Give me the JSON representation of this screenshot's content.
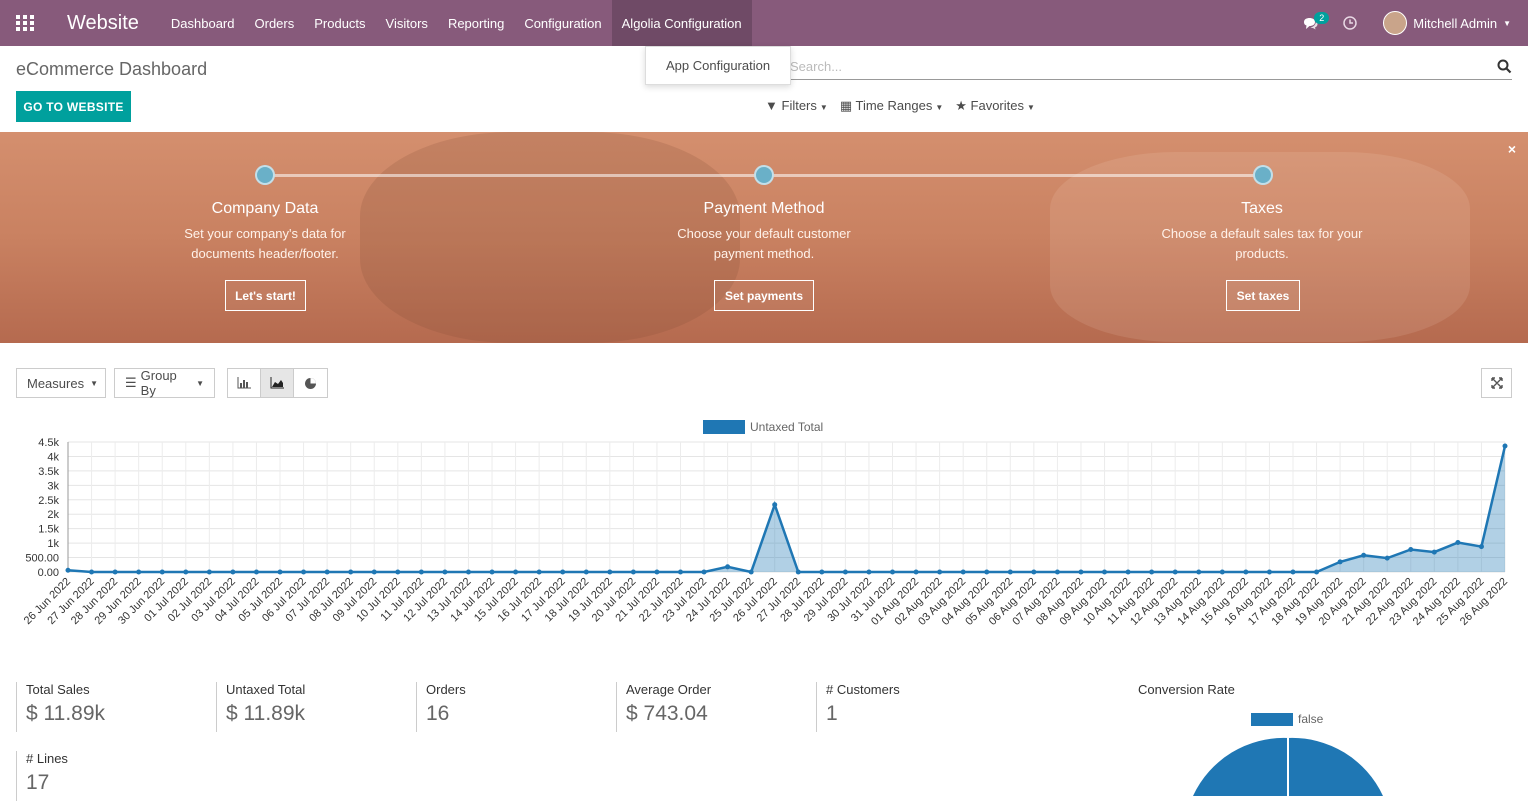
{
  "navbar": {
    "app_title": "Website",
    "menu": [
      "Dashboard",
      "Orders",
      "Products",
      "Visitors",
      "Reporting",
      "Configuration",
      "Algolia Configuration"
    ],
    "messages_count": "2",
    "user_name": "Mitchell Admin",
    "bg_color": "#875a7b"
  },
  "dropdown": {
    "item": "App Configuration"
  },
  "control_panel": {
    "breadcrumb": "eCommerce Dashboard",
    "go_to_website": "GO TO WEBSITE",
    "search_placeholder": "Search...",
    "filters": "Filters",
    "time_ranges": "Time Ranges",
    "favorites": "Favorites"
  },
  "banner": {
    "steps": [
      {
        "title": "Company Data",
        "desc_line1": "Set your company's data for",
        "desc_line2": "documents header/footer.",
        "button": "Let's start!"
      },
      {
        "title": "Payment Method",
        "desc_line1": "Choose your default customer",
        "desc_line2": "payment method.",
        "button": "Set payments"
      },
      {
        "title": "Taxes",
        "desc_line1": "Choose a default sales tax for your",
        "desc_line2": "products.",
        "button": "Set taxes"
      }
    ],
    "close": "×"
  },
  "graph_controls": {
    "measures": "Measures",
    "group_by": "Group By"
  },
  "chart_data": {
    "type": "area",
    "legend": [
      "Untaxed Total"
    ],
    "color": "#1f77b4",
    "y_ticks": [
      "0.00",
      "500.00",
      "1k",
      "1.5k",
      "2k",
      "2.5k",
      "3k",
      "3.5k",
      "4k",
      "4.5k"
    ],
    "ylim": [
      0,
      4500
    ],
    "x": [
      "26 Jun 2022",
      "27 Jun 2022",
      "28 Jun 2022",
      "29 Jun 2022",
      "30 Jun 2022",
      "01 Jul 2022",
      "02 Jul 2022",
      "03 Jul 2022",
      "04 Jul 2022",
      "05 Jul 2022",
      "06 Jul 2022",
      "07 Jul 2022",
      "08 Jul 2022",
      "09 Jul 2022",
      "10 Jul 2022",
      "11 Jul 2022",
      "12 Jul 2022",
      "13 Jul 2022",
      "14 Jul 2022",
      "15 Jul 2022",
      "16 Jul 2022",
      "17 Jul 2022",
      "18 Jul 2022",
      "19 Jul 2022",
      "20 Jul 2022",
      "21 Jul 2022",
      "22 Jul 2022",
      "23 Jul 2022",
      "24 Jul 2022",
      "25 Jul 2022",
      "26 Jul 2022",
      "27 Jul 2022",
      "28 Jul 2022",
      "29 Jul 2022",
      "30 Jul 2022",
      "31 Jul 2022",
      "01 Aug 2022",
      "02 Aug 2022",
      "03 Aug 2022",
      "04 Aug 2022",
      "05 Aug 2022",
      "06 Aug 2022",
      "07 Aug 2022",
      "08 Aug 2022",
      "09 Aug 2022",
      "10 Aug 2022",
      "11 Aug 2022",
      "12 Aug 2022",
      "13 Aug 2022",
      "14 Aug 2022",
      "15 Aug 2022",
      "16 Aug 2022",
      "17 Aug 2022",
      "18 Aug 2022",
      "19 Aug 2022",
      "20 Aug 2022",
      "21 Aug 2022",
      "22 Aug 2022",
      "23 Aug 2022",
      "24 Aug 2022",
      "25 Aug 2022",
      "26 Aug 2022"
    ],
    "values": [
      60,
      0,
      0,
      0,
      0,
      0,
      0,
      0,
      0,
      0,
      0,
      0,
      0,
      0,
      0,
      0,
      0,
      0,
      0,
      0,
      0,
      0,
      0,
      0,
      0,
      0,
      0,
      0,
      180,
      0,
      2330,
      0,
      0,
      0,
      0,
      0,
      0,
      0,
      0,
      0,
      0,
      0,
      0,
      0,
      0,
      0,
      0,
      0,
      0,
      0,
      0,
      0,
      0,
      0,
      350,
      580,
      480,
      780,
      690,
      1020,
      880,
      4360
    ]
  },
  "kpis": [
    {
      "label": "Total Sales",
      "value": "$ 11.89k"
    },
    {
      "label": "Untaxed Total",
      "value": "$ 11.89k"
    },
    {
      "label": "Orders",
      "value": "16"
    },
    {
      "label": "Average Order",
      "value": "$ 743.04"
    },
    {
      "label": "# Customers",
      "value": "1"
    },
    {
      "label": "# Lines",
      "value": "17"
    }
  ],
  "conversion": {
    "title": "Conversion Rate",
    "legend": "false"
  }
}
